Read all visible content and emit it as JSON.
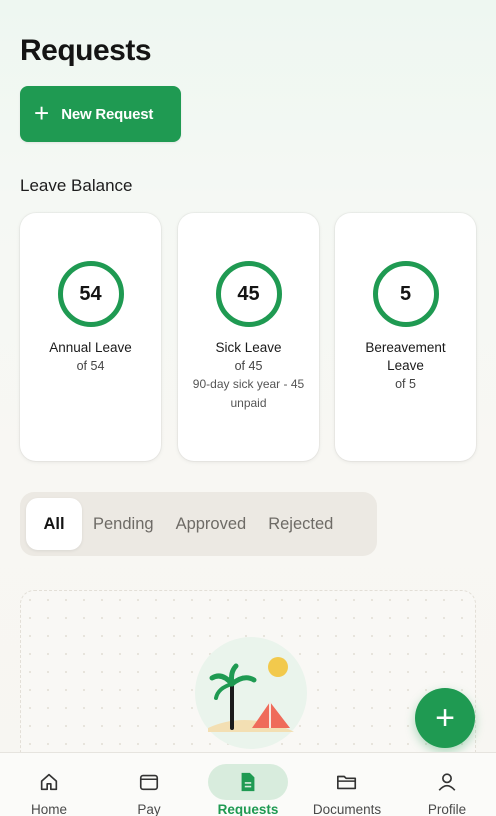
{
  "page": {
    "title": "Requests"
  },
  "actions": {
    "new_request_label": "New Request",
    "new_request_icon": "plus-icon"
  },
  "leave_balance": {
    "heading": "Leave Balance",
    "cards": [
      {
        "value": "54",
        "name": "Annual Leave",
        "of": "of 54",
        "note": ""
      },
      {
        "value": "45",
        "name": "Sick Leave",
        "of": "of 45",
        "note": "90-day sick year - 45 unpaid"
      },
      {
        "value": "5",
        "name": "Bereavement Leave",
        "of": "of 5",
        "note": ""
      }
    ]
  },
  "filters": {
    "tabs": [
      {
        "label": "All",
        "active": true
      },
      {
        "label": "Pending",
        "active": false
      },
      {
        "label": "Approved",
        "active": false
      },
      {
        "label": "Rejected",
        "active": false
      }
    ]
  },
  "empty_state": {
    "illustration": "beach-illustration"
  },
  "fab": {
    "icon": "plus-icon"
  },
  "bottom_nav": {
    "items": [
      {
        "label": "Home",
        "icon": "home-icon",
        "active": false
      },
      {
        "label": "Pay",
        "icon": "wallet-icon",
        "active": false
      },
      {
        "label": "Requests",
        "icon": "document-icon",
        "active": true
      },
      {
        "label": "Documents",
        "icon": "folder-icon",
        "active": false
      },
      {
        "label": "Profile",
        "icon": "person-icon",
        "active": false
      }
    ]
  },
  "colors": {
    "accent": "#1f9a52",
    "accent_soft": "#d8ecdd",
    "background": "#f7f6f2"
  }
}
